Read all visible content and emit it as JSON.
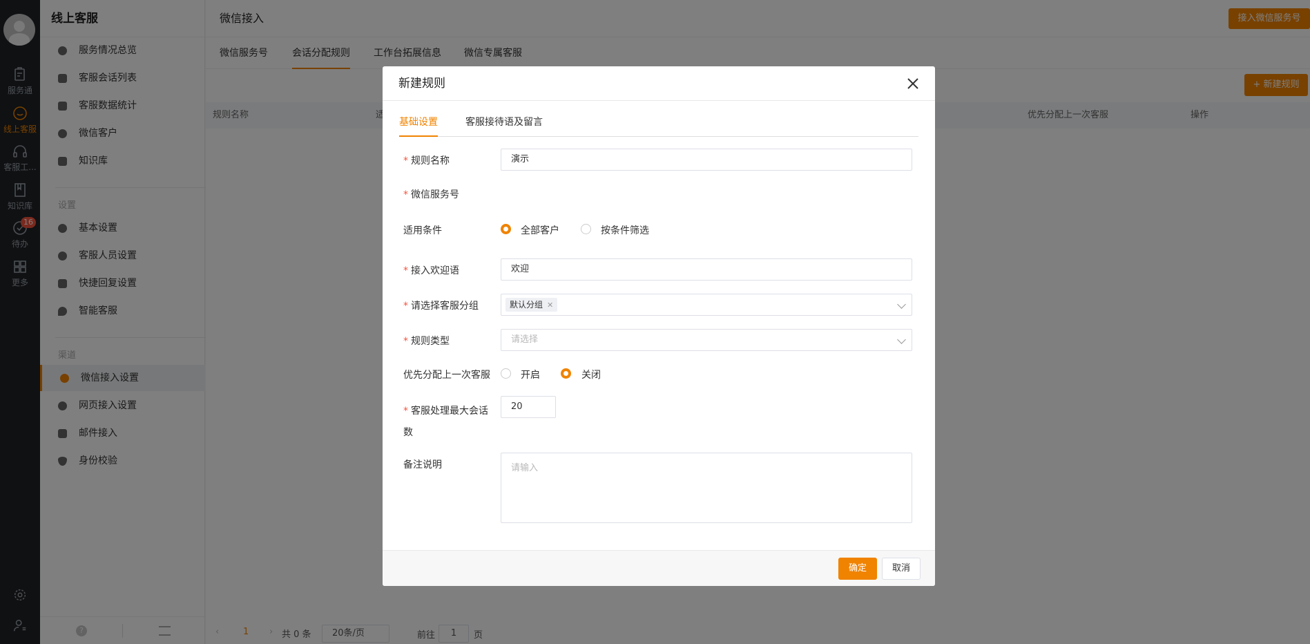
{
  "rail": {
    "items": [
      {
        "label": "服务通",
        "icon": "clipboard-icon"
      },
      {
        "label": "线上客服",
        "icon": "smile-icon",
        "active": true
      },
      {
        "label": "客服工...",
        "icon": "headset-icon"
      },
      {
        "label": "知识库",
        "icon": "book-icon"
      },
      {
        "label": "待办",
        "icon": "check-circle-icon",
        "badge": "16"
      },
      {
        "label": "更多",
        "icon": "grid-icon"
      }
    ]
  },
  "sidebar": {
    "title": "线上客服",
    "items": [
      {
        "label": "服务情况总览",
        "icon": "pie-icon"
      },
      {
        "label": "客服会话列表",
        "icon": "chat-icon"
      },
      {
        "label": "客服数据统计",
        "icon": "bar-chart-icon"
      },
      {
        "label": "微信客户",
        "icon": "wechat-icon"
      },
      {
        "label": "知识库",
        "icon": "book-icon"
      }
    ],
    "settings_label": "设置",
    "settings_items": [
      {
        "label": "基本设置",
        "icon": "gear-icon"
      },
      {
        "label": "客服人员设置",
        "icon": "user-icon"
      },
      {
        "label": "快捷回复设置",
        "icon": "message-icon"
      },
      {
        "label": "智能客服",
        "icon": "robot-icon"
      }
    ],
    "channels_label": "渠道",
    "channel_items": [
      {
        "label": "微信接入设置",
        "icon": "wechat-icon",
        "active": true
      },
      {
        "label": "网页接入设置",
        "icon": "globe-icon"
      },
      {
        "label": "邮件接入",
        "icon": "mail-icon"
      },
      {
        "label": "身份校验",
        "icon": "shield-icon"
      }
    ]
  },
  "header": {
    "title": "微信接入",
    "connect_button": "接入微信服务号"
  },
  "tabs": [
    "微信服务号",
    "会话分配规则",
    "工作台拓展信息",
    "微信专属客服"
  ],
  "toolbar": {
    "new_rule_button": "+ 新建规则"
  },
  "table": {
    "columns": [
      "规则名称",
      "适",
      "优先分配上一次客服",
      "操作"
    ]
  },
  "pager": {
    "current_page": "1",
    "total": "共 0 条",
    "page_size": "20条/页",
    "goto_label": "前往",
    "goto_value": "1",
    "page_suffix": "页"
  },
  "modal": {
    "title": "新建规则",
    "tabs": [
      "基础设置",
      "客服接待语及留言"
    ],
    "fields": {
      "rule_name_label": "规则名称",
      "rule_name_value": "演示",
      "wechat_account_label": "微信服务号",
      "condition_label": "适用条件",
      "condition_options": [
        "全部客户",
        "按条件筛选"
      ],
      "condition_selected": "全部客户",
      "welcome_label": "接入欢迎语",
      "welcome_value": "欢迎",
      "group_label": "请选择客服分组",
      "group_tag": "默认分组",
      "rule_type_label": "规则类型",
      "rule_type_placeholder": "请选择",
      "priority_label": "优先分配上一次客服",
      "priority_options": [
        "开启",
        "关闭"
      ],
      "priority_selected": "关闭",
      "max_sessions_label": "客服处理最大会话数",
      "max_sessions_value": "20",
      "remark_label": "备注说明",
      "remark_placeholder": "请输入"
    },
    "ok_button": "确定",
    "cancel_button": "取消"
  },
  "colors": {
    "accent": "#f08300",
    "rail_bg": "#1f2227",
    "required": "#f5533d"
  }
}
